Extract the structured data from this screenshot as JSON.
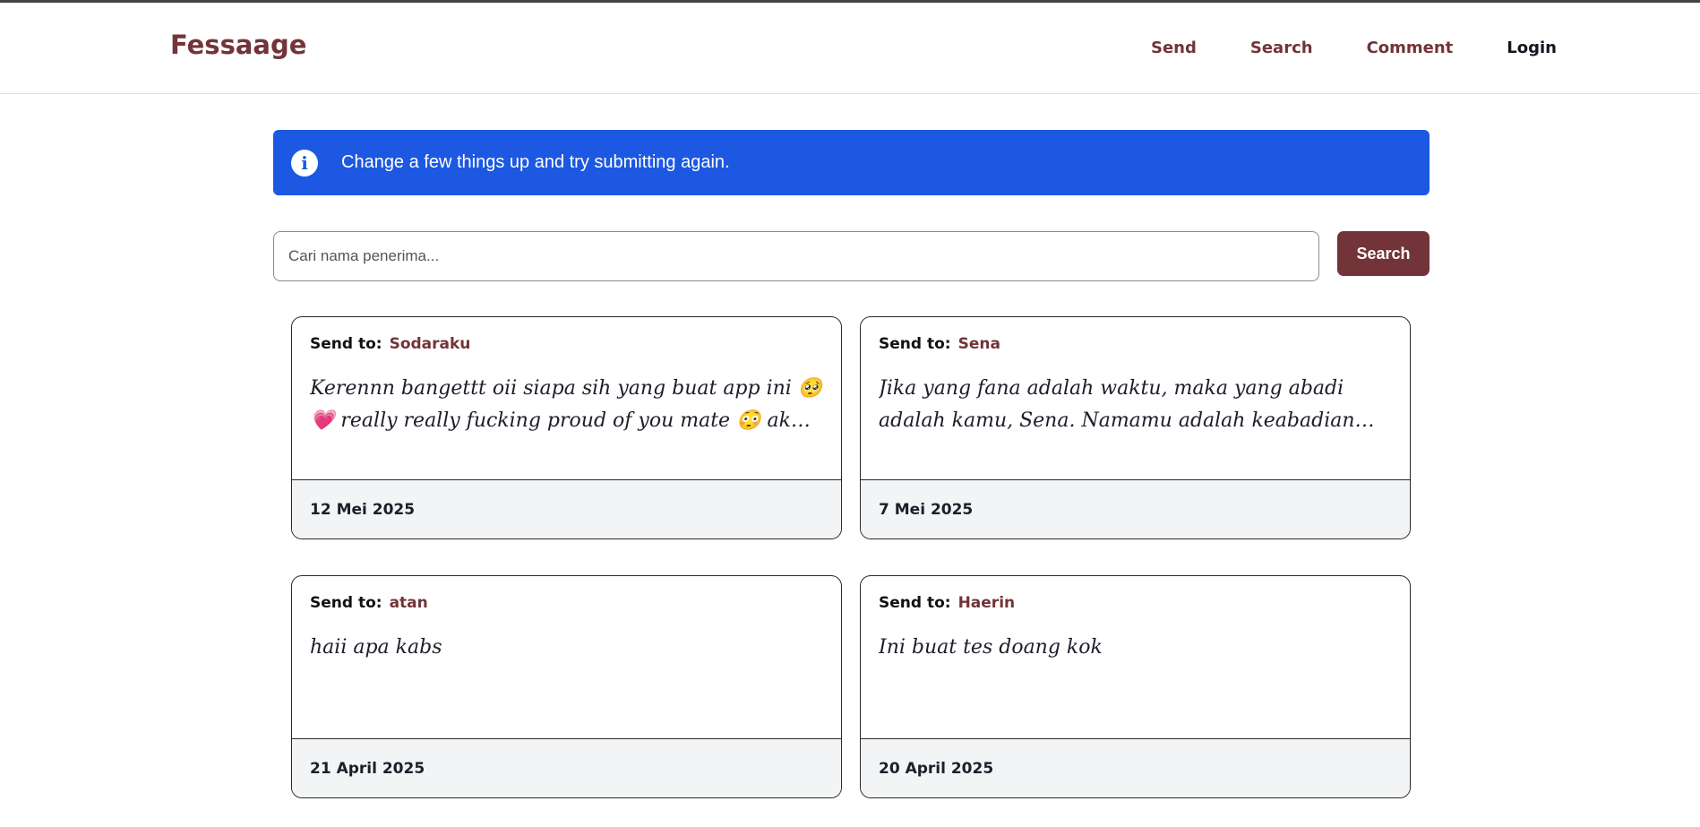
{
  "brand": "Fessaage",
  "nav": {
    "send": "Send",
    "search": "Search",
    "comment": "Comment",
    "login": "Login"
  },
  "alert": {
    "icon": "info-icon",
    "text": "Change a few things up and try submitting again."
  },
  "search": {
    "placeholder": "Cari nama penerima...",
    "value": "",
    "button": "Search"
  },
  "send_to_label": "Send to:",
  "cards": [
    {
      "recipient": "Sodaraku",
      "message": "Kerennn bangettt oii siapa sih yang buat app ini 🥺 💗 really really fucking proud of you mate 😳 aku akan tetap selalu mendukungmu",
      "date": "12 Mei 2025"
    },
    {
      "recipient": "Sena",
      "message": "Jika yang fana adalah waktu, maka yang abadi adalah kamu, Sena. Namamu adalah keabadian yang tak mampu dihapus oleh waktu",
      "date": "7 Mei 2025"
    },
    {
      "recipient": "atan",
      "message": "haii apa kabs",
      "date": "21 April 2025"
    },
    {
      "recipient": "Haerin",
      "message": "Ini buat tes doang kok",
      "date": "20 April 2025"
    }
  ],
  "colors": {
    "brand": "#723438",
    "alert": "#1c58e1",
    "footer": "#f3f4f6"
  }
}
